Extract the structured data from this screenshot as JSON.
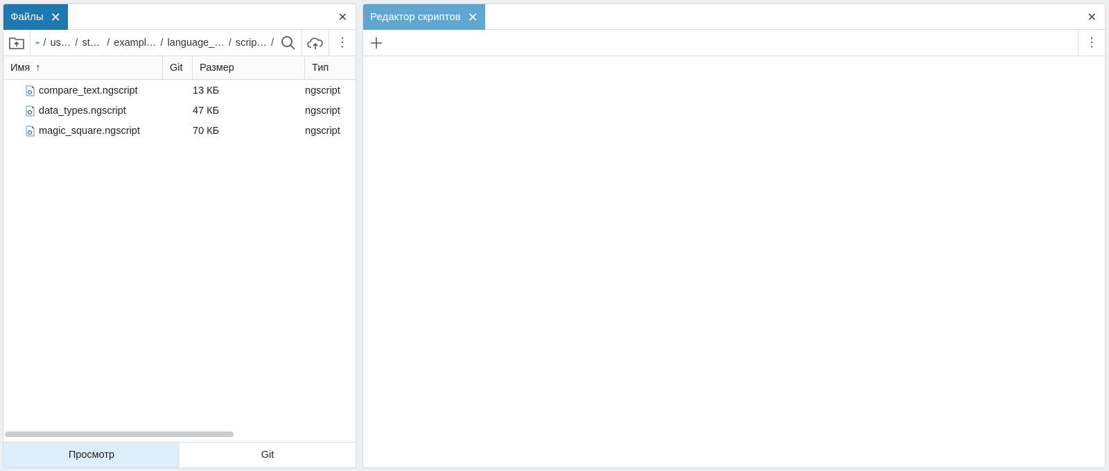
{
  "files_panel": {
    "tab_label": "Файлы",
    "breadcrumbs": [
      "us…",
      "st…",
      "exampl…",
      "language_…",
      "scrip…"
    ],
    "columns": {
      "name": "Имя",
      "git": "Git",
      "size": "Размер",
      "type": "Тип"
    },
    "sort_indicator": "↑",
    "files": [
      {
        "name": "compare_text.ngscript",
        "size": "13 КБ",
        "type": "ngscript"
      },
      {
        "name": "data_types.ngscript",
        "size": "47 КБ",
        "type": "ngscript"
      },
      {
        "name": "magic_square.ngscript",
        "size": "70 КБ",
        "type": "ngscript"
      }
    ],
    "bottom_tabs": {
      "view": "Просмотр",
      "git": "Git"
    }
  },
  "editor_panel": {
    "tab_label": "Редактор скриптов"
  },
  "colors": {
    "active_tab": "#1f78b0",
    "inactive_tab": "#5ea7d0",
    "selected_bottom_tab": "#dceefa"
  }
}
